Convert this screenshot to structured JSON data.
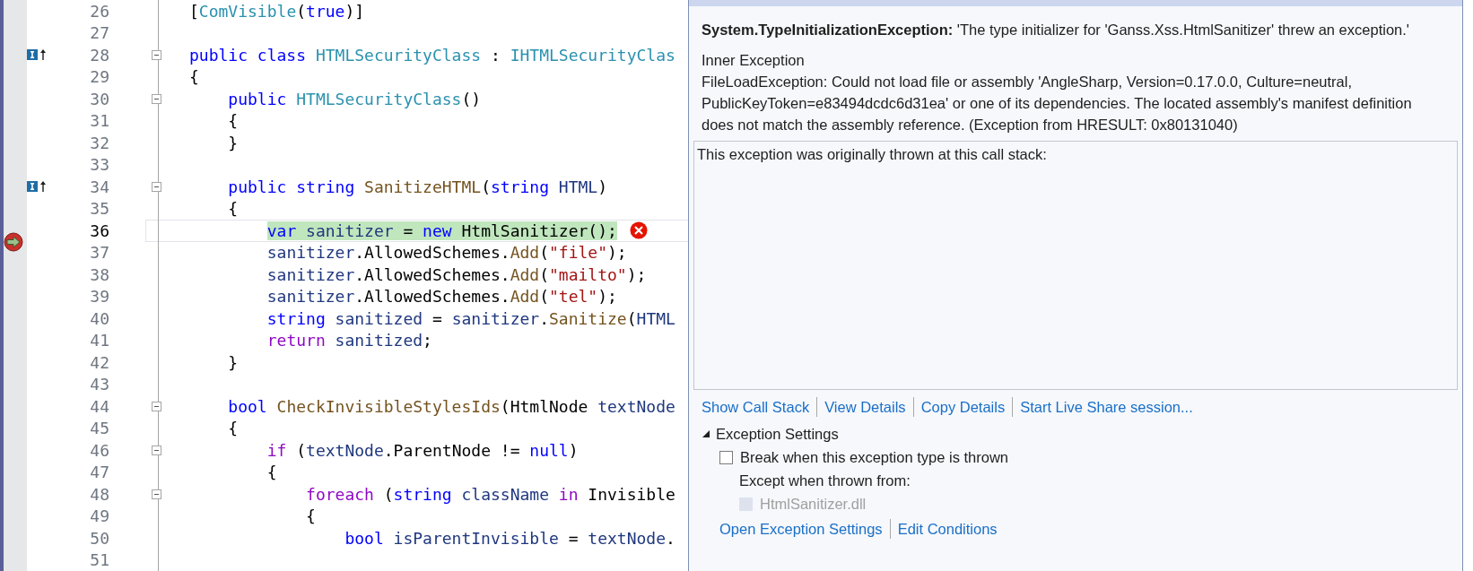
{
  "editor": {
    "lines": [
      {
        "number": "26",
        "current": false,
        "fold": false,
        "lens": false,
        "error": false,
        "tokens": [
          {
            "kind": "plain",
            "text": "["
          },
          {
            "kind": "type",
            "text": "ComVisible"
          },
          {
            "kind": "plain",
            "text": "("
          },
          {
            "kind": "keyword",
            "text": "true"
          },
          {
            "kind": "plain",
            "text": ")]"
          }
        ]
      },
      {
        "number": "27",
        "current": false,
        "fold": false,
        "lens": false,
        "error": false
      },
      {
        "number": "28",
        "current": false,
        "fold": true,
        "lens": true,
        "error": false,
        "tokens": [
          {
            "kind": "keyword",
            "text": "public class"
          },
          {
            "kind": "type",
            "text": " HTMLSecurityClass"
          },
          {
            "kind": "plain",
            "text": " : "
          },
          {
            "kind": "type",
            "text": "IHTMLSecurityClas"
          }
        ]
      },
      {
        "number": "29",
        "current": false,
        "fold": false,
        "lens": false,
        "error": false,
        "tokens": [
          {
            "kind": "plain",
            "text": "{"
          }
        ]
      },
      {
        "number": "30",
        "current": false,
        "fold": true,
        "lens": false,
        "error": false,
        "tokens": [
          {
            "kind": "keyword",
            "text": "    public"
          },
          {
            "kind": "type",
            "text": " HTMLSecurityClass"
          },
          {
            "kind": "plain",
            "text": "()"
          }
        ]
      },
      {
        "number": "31",
        "current": false,
        "fold": false,
        "lens": false,
        "error": false,
        "tokens": [
          {
            "kind": "plain",
            "text": "    {"
          }
        ]
      },
      {
        "number": "32",
        "current": false,
        "fold": false,
        "lens": false,
        "error": false,
        "tokens": [
          {
            "kind": "plain",
            "text": "    }"
          }
        ]
      },
      {
        "number": "33",
        "current": false,
        "fold": false,
        "lens": false,
        "error": false
      },
      {
        "number": "34",
        "current": false,
        "fold": true,
        "lens": true,
        "error": false,
        "tokens": [
          {
            "kind": "keyword",
            "text": "    public string"
          },
          {
            "kind": "method",
            "text": " SanitizeHTML"
          },
          {
            "kind": "plain",
            "text": "("
          },
          {
            "kind": "keyword",
            "text": "string"
          },
          {
            "kind": "variable",
            "text": " HTML"
          },
          {
            "kind": "plain",
            "text": ")"
          }
        ]
      },
      {
        "number": "35",
        "current": false,
        "fold": false,
        "lens": false,
        "error": false,
        "tokens": [
          {
            "kind": "plain",
            "text": "    {"
          }
        ]
      },
      {
        "number": "36",
        "current": true,
        "fold": false,
        "lens": false,
        "error": true,
        "tokens": [
          {
            "kind": "keyword",
            "text": "        var"
          },
          {
            "kind": "variable",
            "text": " sanitizer"
          },
          {
            "kind": "plain",
            "text": " = "
          },
          {
            "kind": "keyword",
            "text": "new"
          },
          {
            "kind": "plain",
            "text": " HtmlSanitizer();"
          }
        ]
      },
      {
        "number": "37",
        "current": false,
        "fold": false,
        "lens": false,
        "error": false,
        "tokens": [
          {
            "kind": "variable",
            "text": "        sanitizer"
          },
          {
            "kind": "plain",
            "text": ".AllowedSchemes."
          },
          {
            "kind": "method",
            "text": "Add"
          },
          {
            "kind": "plain",
            "text": "("
          },
          {
            "kind": "string",
            "text": "\"file\""
          },
          {
            "kind": "plain",
            "text": ");"
          }
        ]
      },
      {
        "number": "38",
        "current": false,
        "fold": false,
        "lens": false,
        "error": false,
        "tokens": [
          {
            "kind": "variable",
            "text": "        sanitizer"
          },
          {
            "kind": "plain",
            "text": ".AllowedSchemes."
          },
          {
            "kind": "method",
            "text": "Add"
          },
          {
            "kind": "plain",
            "text": "("
          },
          {
            "kind": "string",
            "text": "\"mailto\""
          },
          {
            "kind": "plain",
            "text": ");"
          }
        ]
      },
      {
        "number": "39",
        "current": false,
        "fold": false,
        "lens": false,
        "error": false,
        "tokens": [
          {
            "kind": "variable",
            "text": "        sanitizer"
          },
          {
            "kind": "plain",
            "text": ".AllowedSchemes."
          },
          {
            "kind": "method",
            "text": "Add"
          },
          {
            "kind": "plain",
            "text": "("
          },
          {
            "kind": "string",
            "text": "\"tel\""
          },
          {
            "kind": "plain",
            "text": ");"
          }
        ]
      },
      {
        "number": "40",
        "current": false,
        "fold": false,
        "lens": false,
        "error": false,
        "tokens": [
          {
            "kind": "keyword",
            "text": "        string"
          },
          {
            "kind": "variable",
            "text": " sanitized"
          },
          {
            "kind": "plain",
            "text": " = "
          },
          {
            "kind": "variable",
            "text": "sanitizer"
          },
          {
            "kind": "plain",
            "text": "."
          },
          {
            "kind": "method",
            "text": "Sanitize"
          },
          {
            "kind": "plain",
            "text": "("
          },
          {
            "kind": "variable",
            "text": "HTML"
          }
        ]
      },
      {
        "number": "41",
        "current": false,
        "fold": false,
        "lens": false,
        "error": false,
        "tokens": [
          {
            "kind": "control",
            "text": "        return"
          },
          {
            "kind": "variable",
            "text": " sanitized"
          },
          {
            "kind": "plain",
            "text": ";"
          }
        ]
      },
      {
        "number": "42",
        "current": false,
        "fold": false,
        "lens": false,
        "error": false,
        "tokens": [
          {
            "kind": "plain",
            "text": "    }"
          }
        ]
      },
      {
        "number": "43",
        "current": false,
        "fold": false,
        "lens": false,
        "error": false
      },
      {
        "number": "44",
        "current": false,
        "fold": true,
        "lens": false,
        "error": false,
        "tokens": [
          {
            "kind": "keyword",
            "text": "    bool"
          },
          {
            "kind": "method",
            "text": " CheckInvisibleStylesIds"
          },
          {
            "kind": "plain",
            "text": "(HtmlNode "
          },
          {
            "kind": "variable",
            "text": "textNode"
          }
        ]
      },
      {
        "number": "45",
        "current": false,
        "fold": false,
        "lens": false,
        "error": false,
        "tokens": [
          {
            "kind": "plain",
            "text": "    {"
          }
        ]
      },
      {
        "number": "46",
        "current": false,
        "fold": true,
        "lens": false,
        "error": false,
        "tokens": [
          {
            "kind": "control",
            "text": "        if"
          },
          {
            "kind": "plain",
            "text": " ("
          },
          {
            "kind": "variable",
            "text": "textNode"
          },
          {
            "kind": "plain",
            "text": ".ParentNode != "
          },
          {
            "kind": "keyword",
            "text": "null"
          },
          {
            "kind": "plain",
            "text": ")"
          }
        ]
      },
      {
        "number": "47",
        "current": false,
        "fold": false,
        "lens": false,
        "error": false,
        "tokens": [
          {
            "kind": "plain",
            "text": "        {"
          }
        ]
      },
      {
        "number": "48",
        "current": false,
        "fold": true,
        "lens": false,
        "error": false,
        "tokens": [
          {
            "kind": "control",
            "text": "            foreach"
          },
          {
            "kind": "plain",
            "text": " ("
          },
          {
            "kind": "keyword",
            "text": "string"
          },
          {
            "kind": "variable",
            "text": " className"
          },
          {
            "kind": "control",
            "text": " in"
          },
          {
            "kind": "plain",
            "text": " Invisible"
          }
        ]
      },
      {
        "number": "49",
        "current": false,
        "fold": false,
        "lens": false,
        "error": false,
        "tokens": [
          {
            "kind": "plain",
            "text": "            {"
          }
        ]
      },
      {
        "number": "50",
        "current": false,
        "fold": false,
        "lens": false,
        "error": false,
        "tokens": [
          {
            "kind": "keyword",
            "text": "                bool"
          },
          {
            "kind": "variable",
            "text": " isParentInvisible"
          },
          {
            "kind": "plain",
            "text": " = "
          },
          {
            "kind": "variable",
            "text": "textNode"
          },
          {
            "kind": "plain",
            "text": "."
          }
        ]
      },
      {
        "number": "51",
        "current": false,
        "fold": false,
        "lens": false,
        "error": false
      }
    ]
  },
  "exception_popup": {
    "title": "**System.TypeInitializationException:** 'The type initializer for 'Ganss.Xss.HtmlSanitizer' threw an exception.'",
    "inner_heading": "Inner Exception",
    "inner_message": "FileLoadException: Could not load file or assembly 'AngleSharp, Version=0.17.0.0, Culture=neutral, PublicKeyToken=e83494dcdc6d31ea' or one of its dependencies. The located assembly's manifest definition does not match the assembly reference. (Exception from HRESULT: 0x80131040)",
    "call_stack_text": "This exception was originally thrown at this call stack:",
    "links": [
      "Show Call Stack",
      "View Details",
      "Copy Details",
      "Start Live Share session..."
    ],
    "settings": {
      "title": "Exception Settings",
      "expanded": true,
      "break_option": {
        "label": "Break when this exception type is thrown",
        "checked": false,
        "disabled": false
      },
      "except_label": "Except when thrown from:",
      "module_option": {
        "label": "HtmlSanitizer.dll",
        "checked": false,
        "disabled": true
      }
    },
    "bottom_links": [
      "Open Exception Settings",
      "Edit Conditions"
    ]
  }
}
